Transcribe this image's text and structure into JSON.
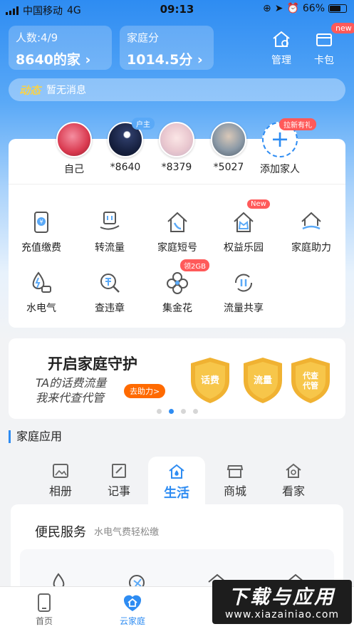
{
  "status_bar": {
    "carrier": "中国移动",
    "network": "4G",
    "time": "09:13",
    "battery": "66%"
  },
  "header": {
    "members": {
      "label": "人数:4/9",
      "value": "8640的家 ›"
    },
    "score": {
      "label": "家庭分",
      "value": "1014.5分 ›"
    },
    "manage_label": "管理",
    "wallet_label": "卡包",
    "wallet_badge": "new"
  },
  "news": {
    "tag": "动态",
    "text": "暂无消息"
  },
  "family": {
    "members": [
      {
        "name": "自己"
      },
      {
        "name": "*8640",
        "badge": "户主"
      },
      {
        "name": "*8379"
      },
      {
        "name": "*5027"
      }
    ],
    "add": {
      "name": "添加家人",
      "badge": "拉新有礼"
    }
  },
  "services": [
    {
      "label": "充值缴费",
      "icon": "recharge-icon"
    },
    {
      "label": "转流量",
      "icon": "transfer-data-icon"
    },
    {
      "label": "家庭短号",
      "icon": "family-short-number-icon"
    },
    {
      "label": "权益乐园",
      "icon": "rights-park-icon",
      "badge": "New"
    },
    {
      "label": "家庭助力",
      "icon": "family-help-icon"
    },
    {
      "label": "水电气",
      "icon": "utilities-icon"
    },
    {
      "label": "查违章",
      "icon": "traffic-violation-icon"
    },
    {
      "label": "集金花",
      "icon": "collect-flower-icon",
      "badge": "领2GB"
    },
    {
      "label": "流量共享",
      "icon": "data-share-icon"
    }
  ],
  "banner": {
    "title": "开启家庭守护",
    "sub1": "TA的话费流量",
    "sub2": "我来代查代管",
    "button": "去助力>",
    "shields": [
      "话费",
      "流量",
      "代查\n代管"
    ]
  },
  "section_title": "家庭应用",
  "tabs": [
    {
      "label": "相册",
      "icon": "photo-icon"
    },
    {
      "label": "记事",
      "icon": "note-icon"
    },
    {
      "label": "生活",
      "icon": "life-icon",
      "active": true
    },
    {
      "label": "商城",
      "icon": "mall-icon"
    },
    {
      "label": "看家",
      "icon": "home-watch-icon"
    }
  ],
  "panel": {
    "title": "便民服务",
    "subtitle": "水电气费轻松缴"
  },
  "bottom_nav": [
    {
      "label": "首页",
      "icon": "phone-icon"
    },
    {
      "label": "云家庭",
      "icon": "cloud-family-icon",
      "active": true
    }
  ],
  "watermark": {
    "line1": "下载与应用",
    "line2": "www.xiazainiao.com"
  },
  "colors": {
    "accent": "#2e8cf2",
    "badge": "#ff5a5a",
    "orange": "#ff6a00",
    "gold": "#f0b232"
  }
}
